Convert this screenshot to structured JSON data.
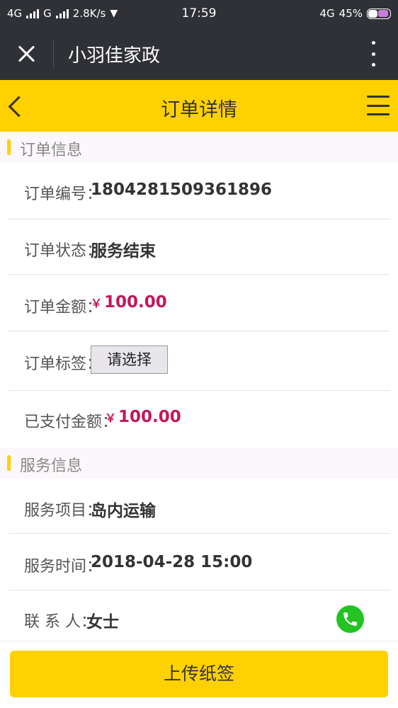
{
  "status_bar": {
    "net1": "4G",
    "net2": "G",
    "speed": "2.8K/s",
    "time": "17:59",
    "net3": "4G",
    "battery": "45%"
  },
  "wechat_bar": {
    "title": "小羽佳家政"
  },
  "nav": {
    "title": "订单详情"
  },
  "order_section": {
    "title": "订单信息",
    "order_no_label": "订单编号",
    "order_no_value": "1804281509361896",
    "status_label": "订单状态",
    "status_value": "服务结束",
    "amount_label": "订单金额",
    "amount_currency": "￥",
    "amount_value": "100.00",
    "tag_label": "订单标签",
    "tag_select_value": "请选择",
    "paid_label": "已支付金额",
    "paid_currency": "￥",
    "paid_value": "100.00"
  },
  "service_section": {
    "title": "服务信息",
    "item_label": "服务项目",
    "item_value": "岛内运输",
    "time_label": "服务时间",
    "time_value": "2018-04-28 15:00",
    "contact_label": "联 系 人",
    "contact_value": "女士"
  },
  "footer": {
    "upload_label": "上传纸签"
  },
  "colors": {
    "accent": "#ffd100",
    "money": "#c2185b",
    "call": "#22c322",
    "header_dark": "#2f3136"
  },
  "icons": [
    "close-icon",
    "more-vertical-icon",
    "back-arrow-icon",
    "menu-icon",
    "phone-icon"
  ]
}
